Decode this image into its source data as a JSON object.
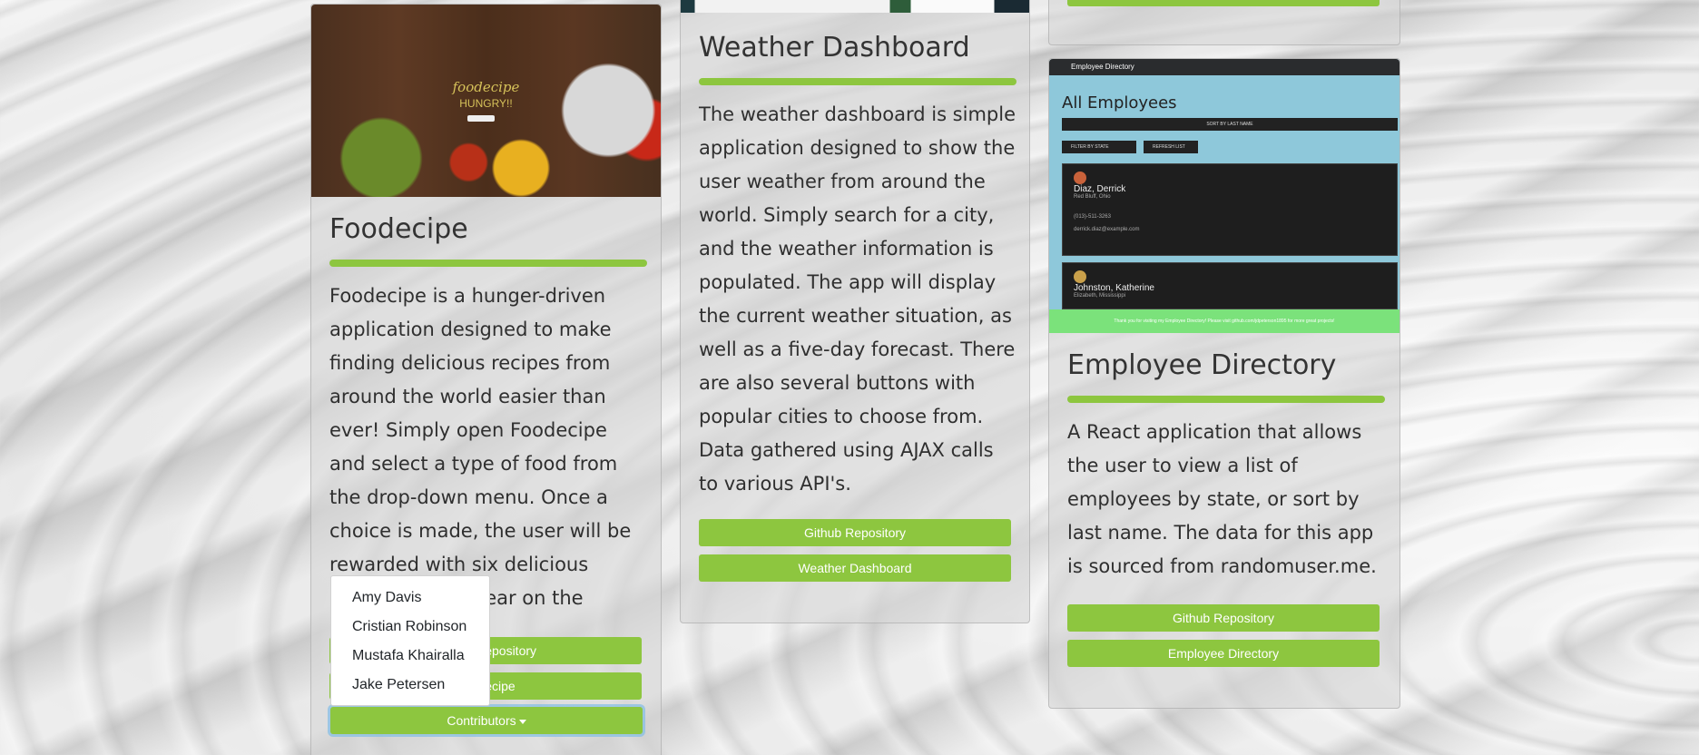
{
  "colors": {
    "accent": "#8dc63f",
    "text": "#2f2f2f"
  },
  "cards": {
    "foodecipe": {
      "image": {
        "logo": "foodecipe",
        "tagline": "HUNGRY!!"
      },
      "title": "Foodecipe",
      "description": "Foodecipe is a hunger-driven application designed to make finding delicious recipes from around the world easier than ever! Simply open Foodecipe and select a type of food from the drop-down menu. Once a choice is made, the user will be rewarded with six delicious recipes that appear on the screen.",
      "buttons": [
        "Github Repository",
        "Foodecipe"
      ],
      "contributors_label": "Contributors",
      "contributors": [
        "Amy Davis",
        "Cristian Robinson",
        "Mustafa Khairalla",
        "Jake Petersen"
      ]
    },
    "weather": {
      "title": "Weather Dashboard",
      "description": "The weather dashboard is simple application designed to show the user weather from around the world. Simply search for a city, and the weather information is populated. The app will display the current weather situation, as well as a five-day forecast. There are also several buttons with popular cities to choose from. Data gathered using AJAX calls to various API's.",
      "buttons": [
        "Github Repository",
        "Weather Dashboard"
      ]
    },
    "employee": {
      "image": {
        "nav_title": "Employee Directory",
        "heading": "All Employees",
        "sort_label": "SORT BY LAST NAME",
        "filter_label": "FILTER BY STATE",
        "refresh_label": "REFRESH LIST",
        "employees": [
          {
            "name": "Diaz, Derrick",
            "location": "Red Bluff, Ohio",
            "phone": "(013)-511-3263",
            "email": "derrick.diaz@example.com"
          },
          {
            "name": "Johnston, Katherine",
            "location": "Elizabeth, Mississippi"
          }
        ],
        "footer": "Thank you for visiting my Employee Directory! Please visit github.com/jdpeterson1895 for more great projects!"
      },
      "title": "Employee Directory",
      "description": "A React application that allows the user to view a list of employees by state, or sort by last name. The data for this app is sourced from randomuser.me.",
      "buttons": [
        "Github Repository",
        "Employee Directory"
      ]
    }
  }
}
